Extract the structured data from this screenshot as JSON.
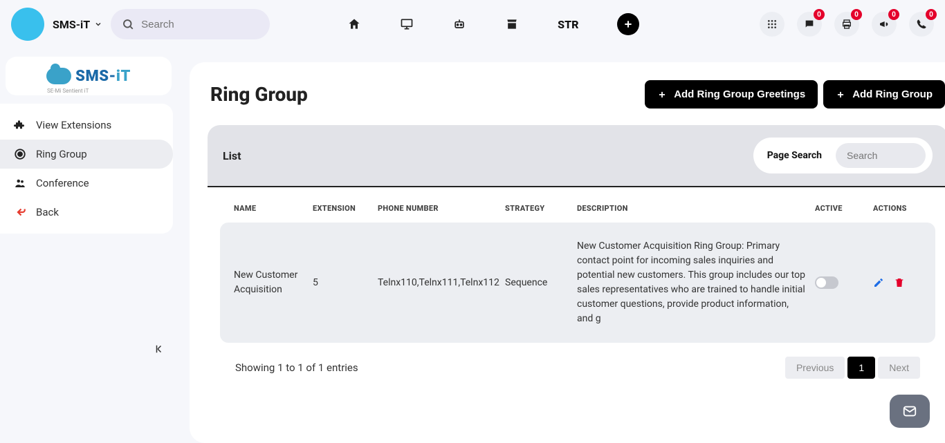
{
  "header": {
    "org_name": "SMS-iT",
    "search_placeholder": "Search",
    "nav": {
      "str": "STR"
    },
    "badges": {
      "chat": "0",
      "print": "0",
      "announce": "0",
      "phone": "0"
    }
  },
  "sidebar": {
    "logo_main": "SMS-",
    "logo_accent": "iT",
    "logo_sub": "SE-Mi Sentient iT",
    "items": [
      {
        "label": "View Extensions"
      },
      {
        "label": "Ring Group"
      },
      {
        "label": "Conference"
      },
      {
        "label": "Back"
      }
    ]
  },
  "page": {
    "title": "Ring Group",
    "btn_greetings": "Add Ring Group Greetings",
    "btn_add": "Add Ring Group",
    "list_label": "List",
    "page_search_label": "Page Search",
    "page_search_placeholder": "Search",
    "columns": {
      "name": "NAME",
      "extension": "EXTENSION",
      "phone": "PHONE NUMBER",
      "strategy": "STRATEGY",
      "description": "DESCRIPTION",
      "active": "ACTIVE",
      "actions": "ACTIONS"
    },
    "rows": [
      {
        "name": "New Customer Acquisition",
        "extension": "5",
        "phone": "Telnx110,Telnx111,Telnx112",
        "strategy": "Sequence",
        "description": "New Customer Acquisition Ring Group: Primary contact point for incoming sales inquiries and potential new customers. This group includes our top sales representatives who are trained to handle initial customer questions, provide product information, and g"
      }
    ],
    "entries_text": "Showing 1 to 1 of 1 entries",
    "pagination": {
      "prev": "Previous",
      "current": "1",
      "next": "Next"
    }
  }
}
